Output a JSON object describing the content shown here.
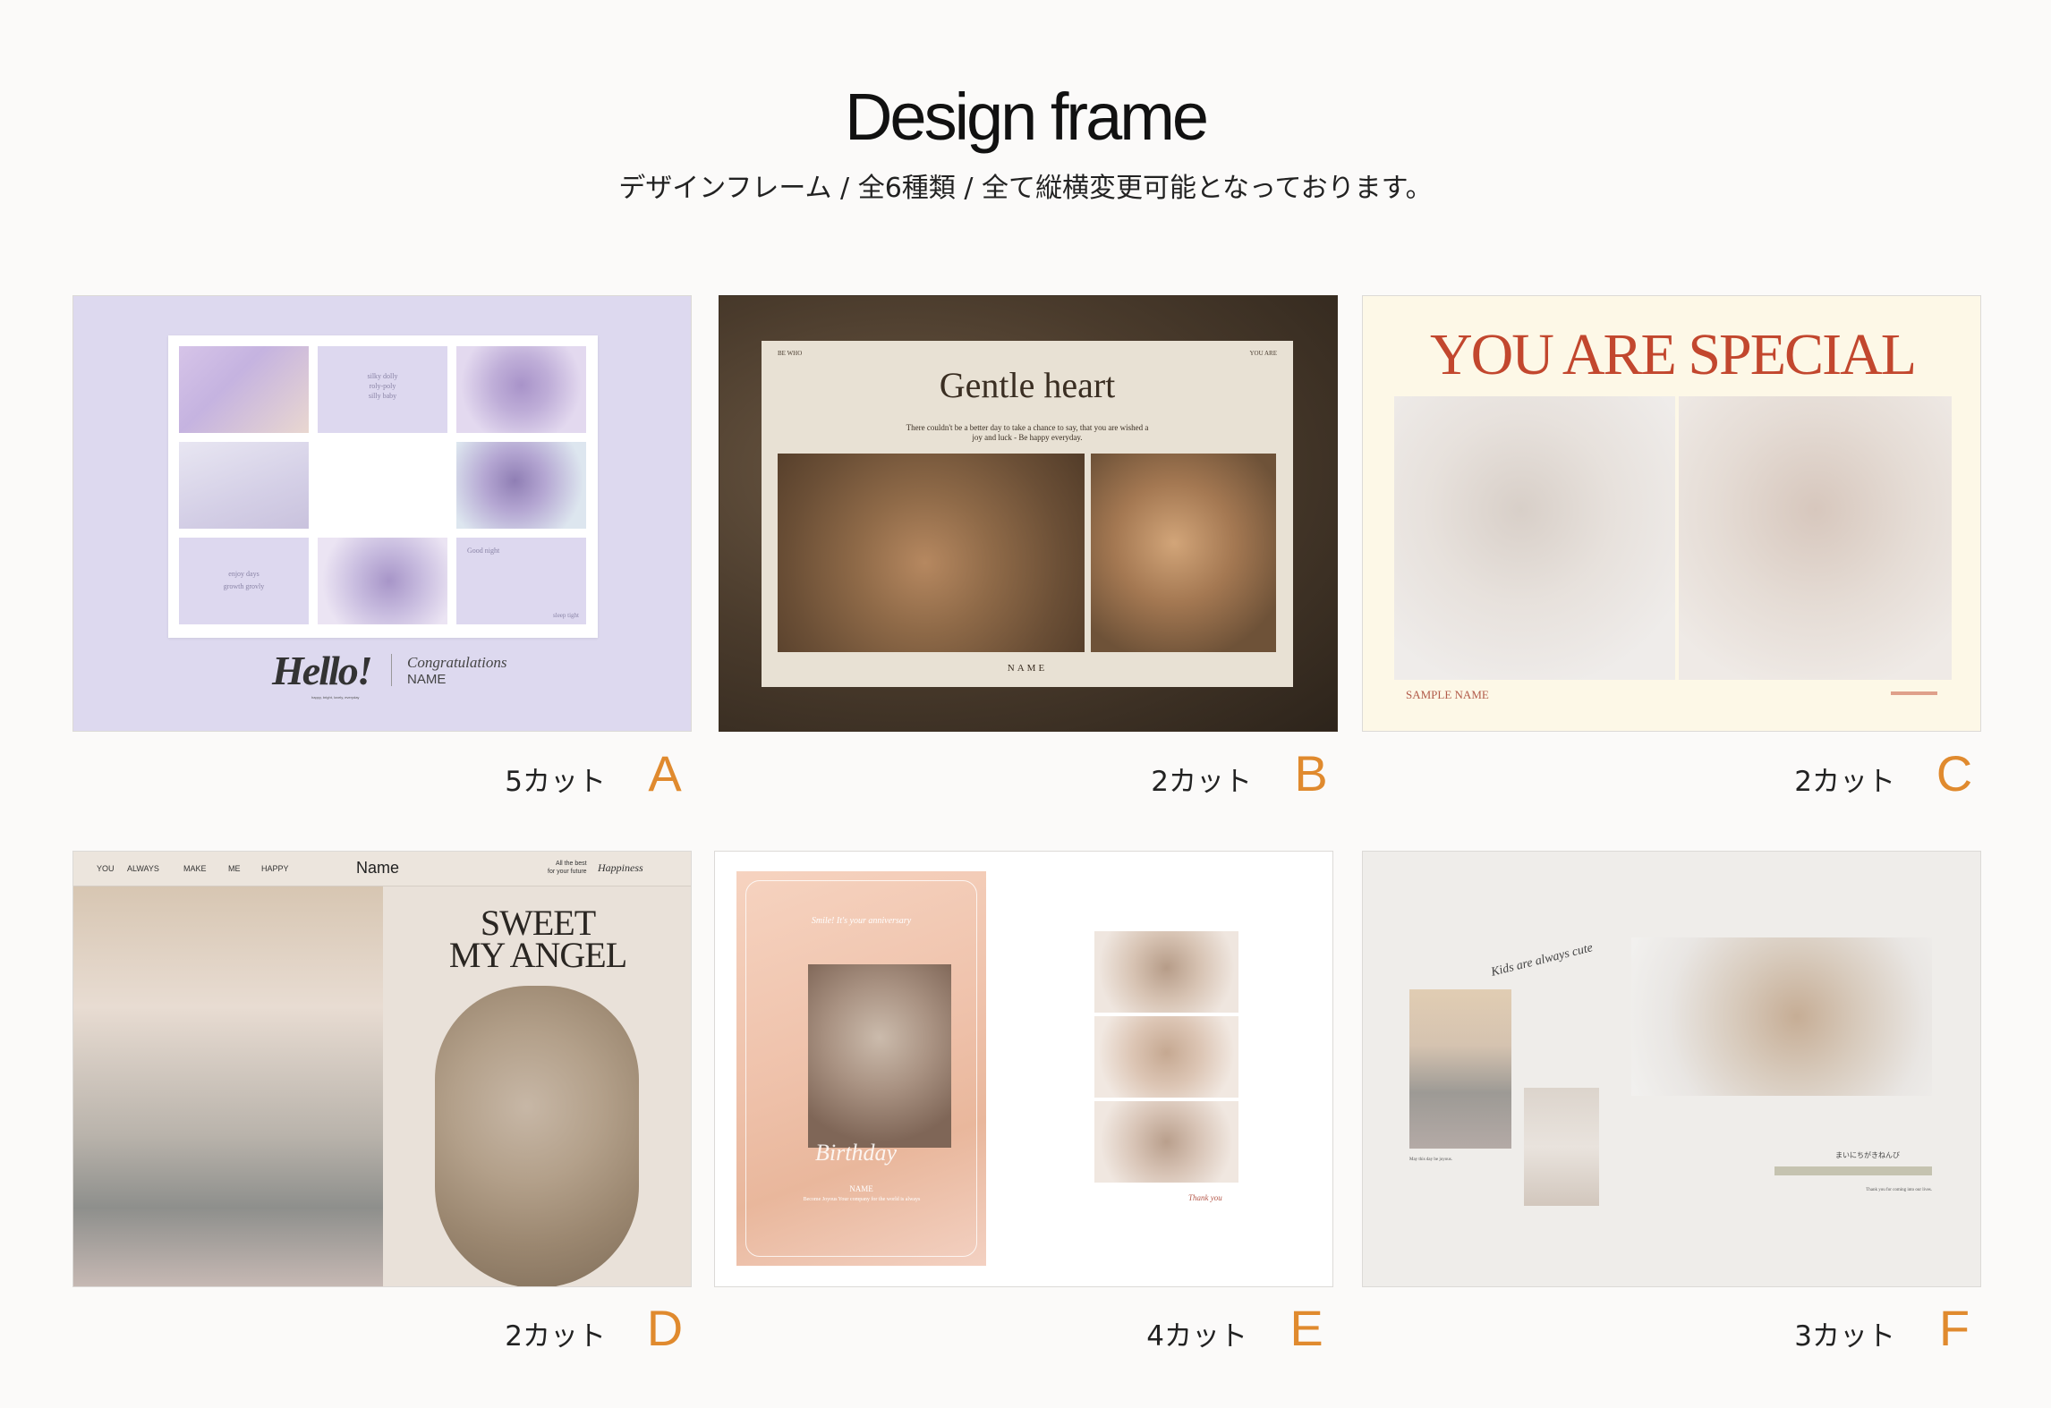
{
  "header": {
    "title": "Design frame",
    "subtitle": "デザインフレーム / 全6種類 / 全て縦横変更可能となっております。"
  },
  "colors": {
    "accent": "#e08a2e",
    "text": "#222222"
  },
  "frames": [
    {
      "letter": "A",
      "cut": "5カット",
      "texts": {
        "hello": "Hello!",
        "hello_sub": "happy, bright, lovely, everyday",
        "congrats": "Congratulations",
        "name": "NAME",
        "tile1": "silky dolly\nroly-poly\nsilly baby",
        "tile2": "enjoy days\ngrowth grovly",
        "tile3": "Good night",
        "tile4": "sleep tight"
      }
    },
    {
      "letter": "B",
      "cut": "2カット",
      "texts": {
        "left": "BE WHO",
        "right": "YOU ARE",
        "heading": "Gentle heart",
        "body": "There couldn't be a better day to take a chance to say, that you are wished a joy and luck - Be happy everyday.",
        "name": "NAME"
      }
    },
    {
      "letter": "C",
      "cut": "2カット",
      "texts": {
        "heading": "YOU ARE SPECIAL",
        "name": "SAMPLE NAME"
      }
    },
    {
      "letter": "D",
      "cut": "2カット",
      "texts": {
        "nav": [
          "YOU",
          "ALWAYS",
          "MAKE",
          "ME",
          "HAPPY"
        ],
        "name": "Name",
        "allbest": "All the best\nfor your future",
        "script": "Happiness",
        "heading1": "SWEET",
        "heading2": "MY ANGEL"
      }
    },
    {
      "letter": "E",
      "cut": "4カット",
      "texts": {
        "smile": "Smile! It's your anniversary",
        "birthday": "Birthday",
        "name": "NAME",
        "body": "Become Joyous Your company for the world is always",
        "thanks": "Thank you"
      }
    },
    {
      "letter": "F",
      "cut": "3カット",
      "texts": {
        "script": "Kids are always cute",
        "jp": "まいにちがきねんび",
        "left_body": "May this day be joyous.",
        "right_body": "Thank you for coming into our lives."
      }
    }
  ]
}
